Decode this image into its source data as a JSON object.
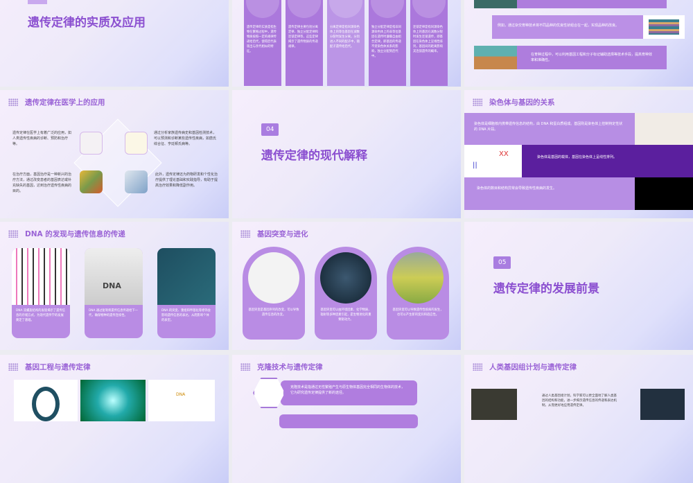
{
  "slides": {
    "s1": {
      "title": "遗传定律的实质及应用"
    },
    "s2": {
      "cards": [
        "遗传定律的实质是指生物在繁殖过程中，遗传物质按照一定的规律传递给后代，使得后代表现出与亲代相似的特征。",
        "遗传定律主要包括分离定律、独立分配定律和连锁定律等，这些定律揭示了遗传物质的传递规律。",
        "分离定律是指同源染色体上的等位基因在减数分裂时发生分离，分别进入不同的配子中，随配子遗传给后代。",
        "独立分配定律是指非同源染色体上的非等位基因在遗传时遵循自由组合定律，即基因的传递不受染色体关系的影响，独立分配到后代中。",
        "连锁定律是指同源染色体上的基因在减数分裂时发生连锁遗传，即基因在染色体上呈线性排列，基因间的距离影响其连锁遗传的概率。"
      ]
    },
    "s3": {
      "rows": [
        "例如，通过杂交育种技术将不同品种的优良性状组合在一起，实现品种的改良。",
        "在育种过程中，可以利用基因工程和分子标记辅助选择等技术手段，提高育种效率和准确性。"
      ]
    },
    "s4": {
      "title": "遗传定律在医学上的应用",
      "texts": [
        "遗传定律在医学上有着广泛的应用，如人类遗传性疾病的诊断、预防和治疗等。",
        "通过分析家族遗传病史和基因检测技术，可以预测和诊断某些遗传性疾病，如唐氏综合征、亨廷顿氏病等。",
        "在治疗方面，基因治疗是一种新兴的治疗方法，通过改变患者的基因表达或补充缺失的基因，达到治疗遗传性疾病的目的。",
        "此外，遗传定律还为药物研发和个性化治疗提供了理论基础和实践指导，有助于提高治疗效果和降低副作用。"
      ]
    },
    "s5": {
      "number": "04",
      "title": "遗传定律的现代解释"
    },
    "s6": {
      "title": "染色体与基因的关系",
      "rows": [
        "染色体是细胞核内携带遗传信息的结构，由 DNA 和蛋白质组成。基因则是染色体上控制特定性状的 DNA 片段。",
        "染色体是基因的载体，基因在染色体上呈线性排列。",
        "染色体的数目和结构异常会导致遗传性疾病的发生。"
      ]
    },
    "s7": {
      "title": "DNA 的发现与遗传信息的传递",
      "img_label": "DNA",
      "cards": [
        "DNA 双螺旋结构的发现揭示了遗传信息的存储方式，为现代遗传学的发展奠定了基础。",
        "DNA 通过复制将遗传信息传递给下一代，确保物种的遗传连续性。",
        "DNA 的突变、重组和甲基化等修饰会影响遗传信息的表达，从而影响个体的表型。"
      ]
    },
    "s8": {
      "title": "基因突变与进化",
      "cards": [
        "基因突变是基因序列的改变，可以导致遗传信息的改变。",
        "基因突变可以由环境因素、化学物质、辐射等多种因素引起，是生物进化的重要驱动力。",
        "基因突变可以导致遗传性疾病的发生，也可以产生新的变异和适应性。"
      ]
    },
    "s9": {
      "number": "05",
      "title": "遗传定律的发展前景"
    },
    "s10": {
      "title": "基因工程与遗传定律",
      "img_label": "DNA"
    },
    "s11": {
      "title": "克隆技术与遗传定律",
      "text": "克隆技术是指通过无性繁殖产生与原生物体基因完全相同的生物体的技术，它为研究遗传定律提供了新的途径。"
    },
    "s12": {
      "title": "人类基因组计划与遗传定律",
      "text": "通过人类基因组计划，科学家可以更全面地了解人类基因的结构和功能，进一步揭示遗传信息的传递和表达机制，从而更好地应用遗传定律。"
    }
  },
  "colors": {
    "accent": "#9a63d6",
    "card": "#b07ddf",
    "dark": "#5b1f9e"
  }
}
